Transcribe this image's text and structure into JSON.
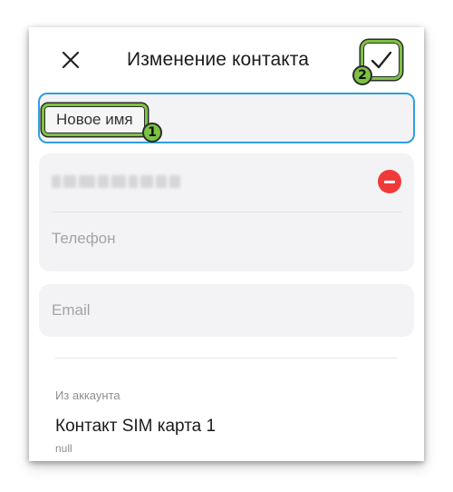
{
  "header": {
    "title": "Изменение контакта",
    "close_icon": "close-icon",
    "confirm_icon": "checkmark-icon"
  },
  "name_field": {
    "placeholder": "Новое имя"
  },
  "phone_section": {
    "phone_placeholder": "Телефон",
    "remove_icon": "remove-circle-icon"
  },
  "email_section": {
    "placeholder": "Email"
  },
  "account": {
    "caption": "Из аккаунта",
    "name": "Контакт SIM карта 1",
    "type": "null"
  },
  "annotations": {
    "step1": "1",
    "step2": "2",
    "highlight_color": "#7dc242"
  },
  "colors": {
    "focus_border": "#2f9fe0",
    "remove_red": "#f03a3a",
    "field_bg": "#f3f3f5"
  }
}
